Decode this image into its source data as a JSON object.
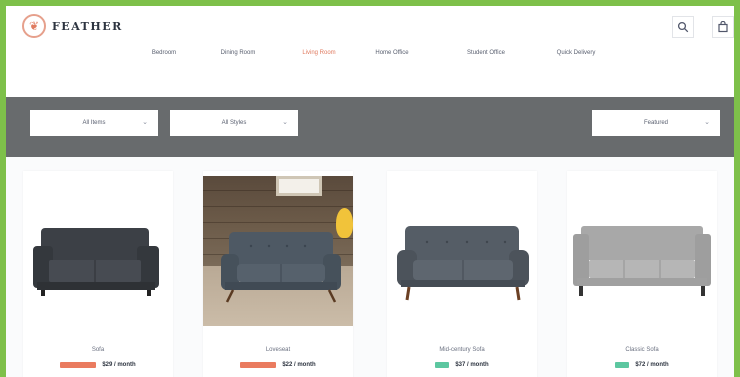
{
  "brand": {
    "name": "FEATHER"
  },
  "nav": {
    "items": [
      {
        "label": "Bedroom",
        "active": false
      },
      {
        "label": "Dining Room",
        "active": false
      },
      {
        "label": "Living Room",
        "active": true
      },
      {
        "label": "Home Office",
        "active": false
      },
      {
        "label": "Student Office",
        "active": false
      },
      {
        "label": "Quick Delivery",
        "active": false
      }
    ]
  },
  "filters": {
    "left1": "All Items",
    "left2": "All Styles",
    "right": "Featured"
  },
  "products": [
    {
      "name": "Sofa",
      "price": "$29 / month",
      "badge": "orange",
      "image": "sofa-dark"
    },
    {
      "name": "Loveseat",
      "price": "$22 / month",
      "badge": "orange",
      "image": "sofa-room"
    },
    {
      "name": "Mid-century Sofa",
      "price": "$37 / month",
      "badge": "green",
      "image": "sofa-mid"
    },
    {
      "name": "Classic Sofa",
      "price": "$72 / month",
      "badge": "green",
      "image": "sofa-light"
    }
  ],
  "icons": {
    "search": "search-icon",
    "cart": "cart-icon"
  },
  "colors": {
    "accent": "#e07b60",
    "bar": "#686b6d",
    "green_badge": "#5cc7a0",
    "orange_badge": "#ea7b5f"
  }
}
